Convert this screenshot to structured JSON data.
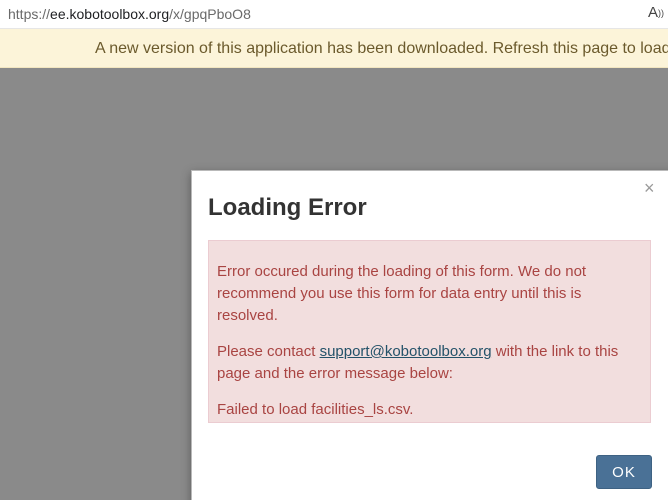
{
  "browser": {
    "url_scheme": "https://",
    "url_host": "ee.kobotoolbox.org",
    "url_path": "/x/gpqPboO8",
    "reader_icon": "reader-view-icon"
  },
  "banner": {
    "text": "A new version of this application has been downloaded. Refresh this page to load the updated version."
  },
  "modal": {
    "title": "Loading Error",
    "close_glyph": "×",
    "message_line1": "Error occured during the loading of this form. We do not recommend you use this form for data entry until this is resolved.",
    "contact_prefix": "Please contact ",
    "contact_link": "support@kobotoolbox.org",
    "contact_suffix": " with the link to this page and the error message below:",
    "error_message": "Failed to load facilities_ls.csv.",
    "ok_label": "OK"
  },
  "colors": {
    "banner_bg": "#fcf4d9",
    "overlay": "#8a8a8a",
    "alert_bg": "#f2dede",
    "alert_text": "#a94442",
    "button_bg": "#4a7196"
  }
}
